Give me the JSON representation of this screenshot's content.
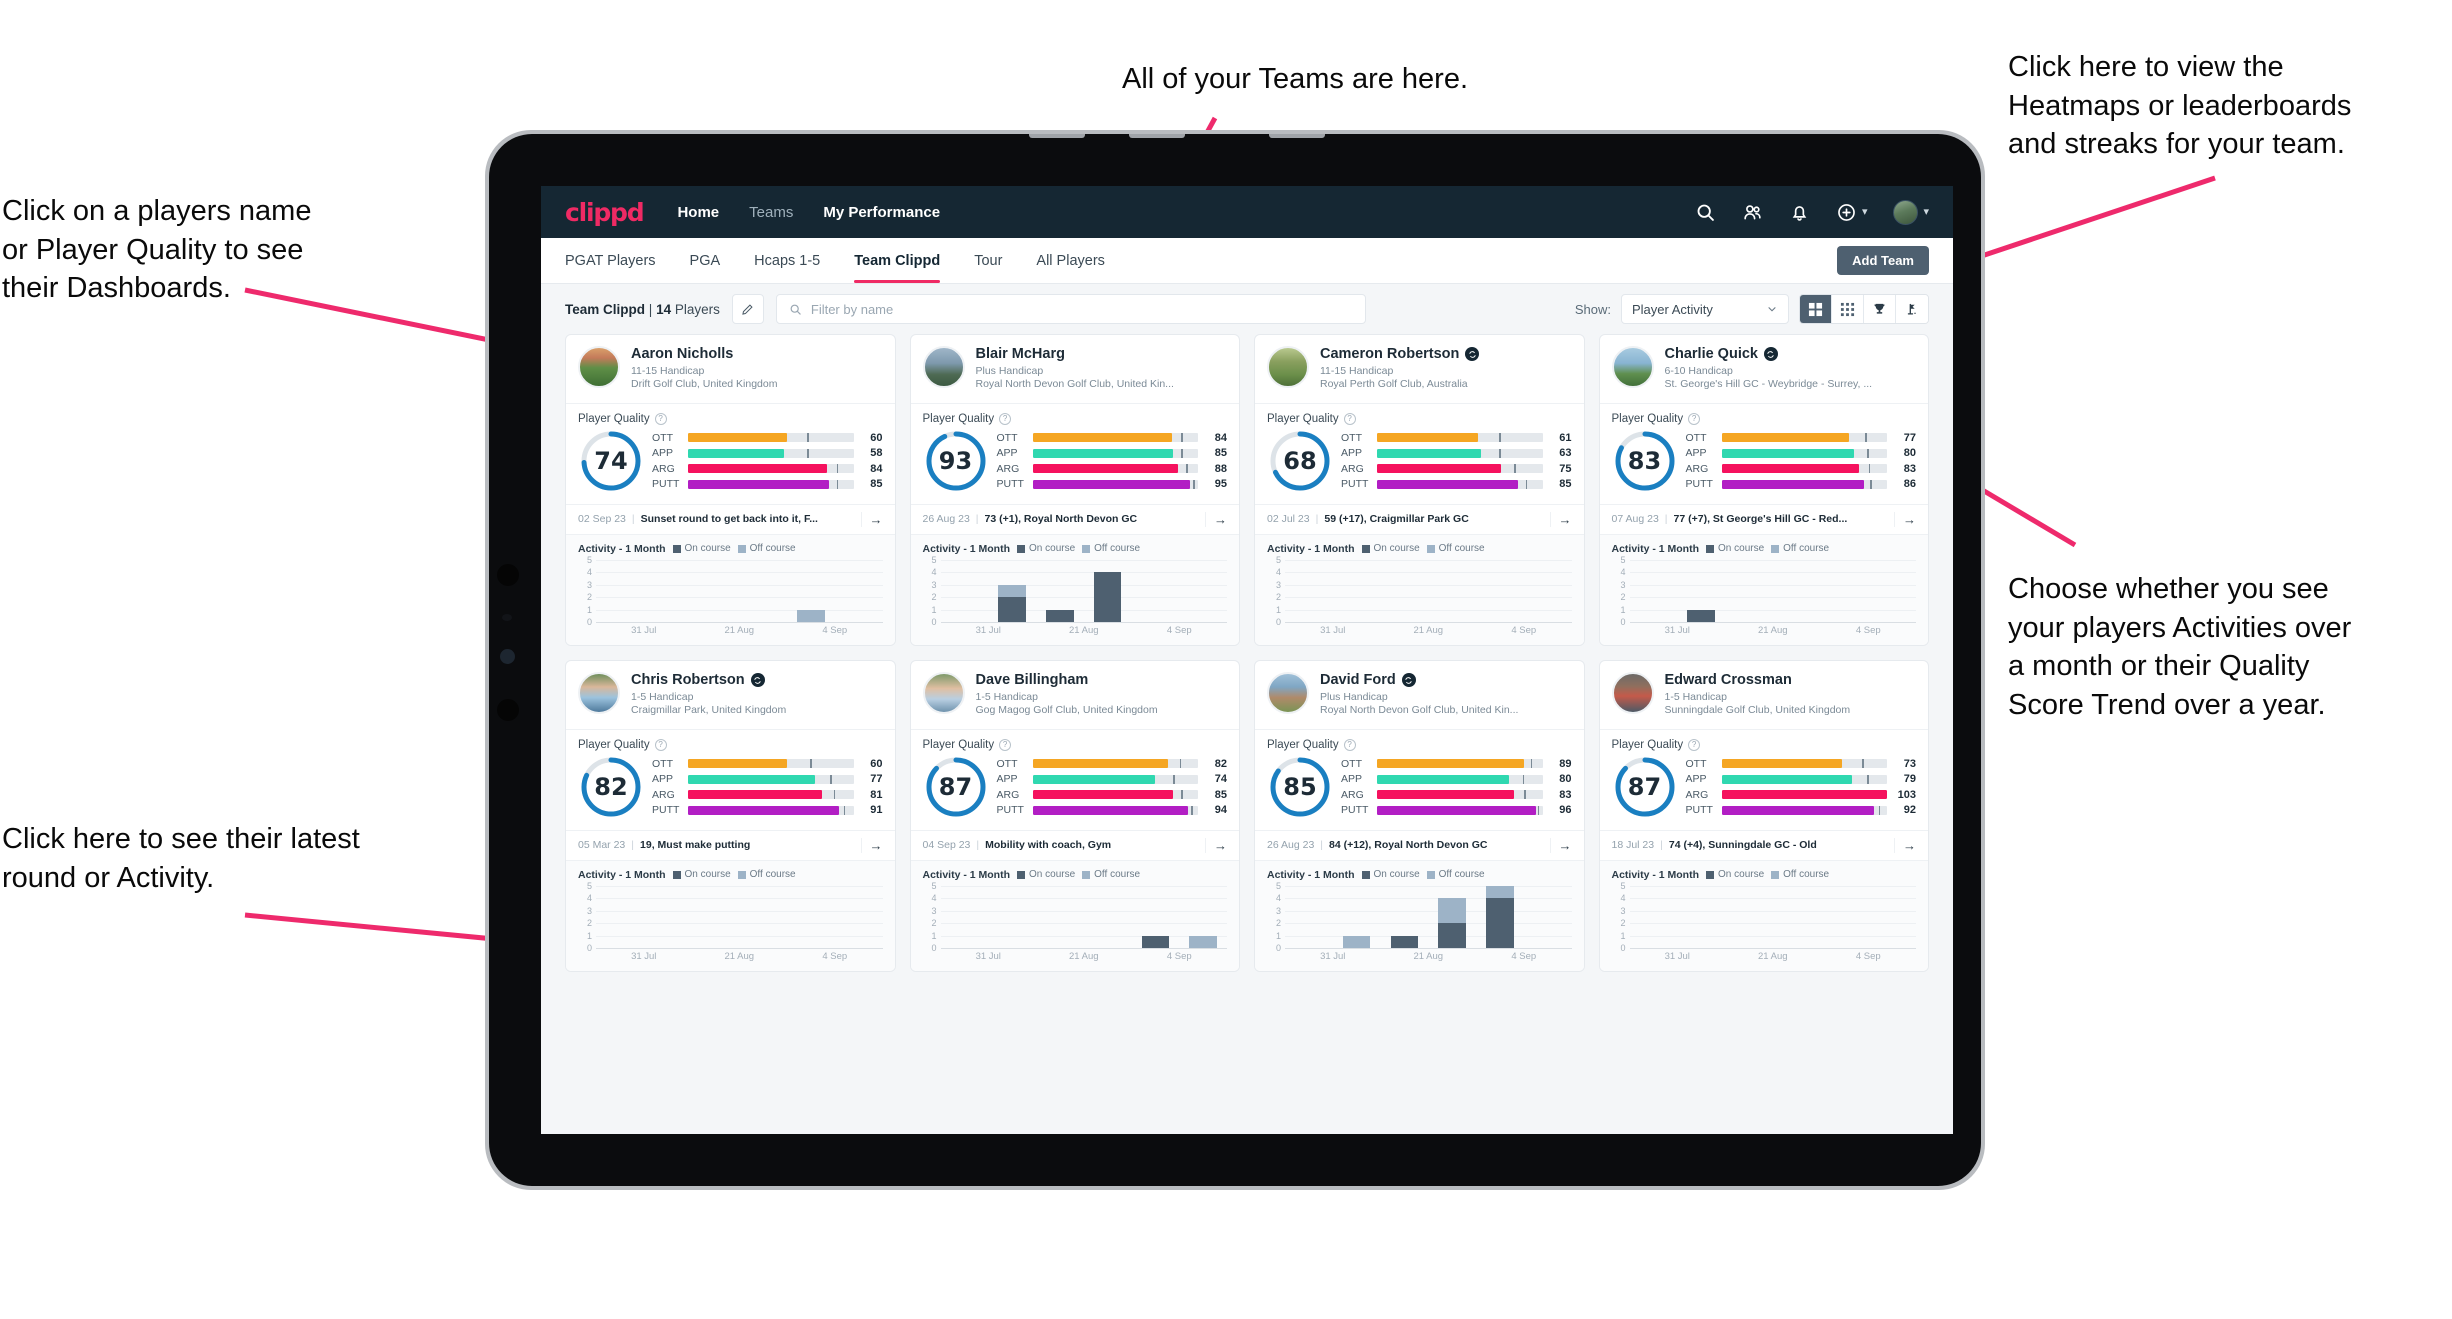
{
  "annotations": {
    "teams": "All of your Teams are here.",
    "heatmaps": "Click here to view the\nHeatmaps or leaderboards\nand streaks for your team.",
    "player_names": "Click on a players name\nor Player Quality to see\ntheir Dashboards.",
    "choose": "Choose whether you see\nyour players Activities over\na month or their Quality\nScore Trend over a year.",
    "latest": "Click here to see their latest\nround or Activity."
  },
  "app": {
    "logo": "clippd",
    "nav_links": [
      {
        "label": "Home",
        "active": true
      },
      {
        "label": "Teams",
        "active": false
      },
      {
        "label": "My Performance",
        "active": true
      }
    ],
    "nav_icons": [
      "search-icon",
      "people-icon",
      "bell-icon",
      "plus-circle-icon",
      "avatar"
    ],
    "tabs": [
      {
        "label": "PGAT Players",
        "active": false
      },
      {
        "label": "PGA",
        "active": false
      },
      {
        "label": "Hcaps 1-5",
        "active": false
      },
      {
        "label": "Team Clippd",
        "active": true
      },
      {
        "label": "Tour",
        "active": false
      },
      {
        "label": "All Players",
        "active": false
      }
    ],
    "add_team_label": "Add Team",
    "filter": {
      "team_name": "Team Clippd",
      "separator": "|",
      "player_count": "14",
      "players_word": "Players",
      "edit_icon": "pencil-icon",
      "search_placeholder": "Filter by name",
      "search_value": "",
      "show_label": "Show:",
      "show_value": "Player Activity",
      "show_options": [
        "Player Activity",
        "Quality Score Trend"
      ],
      "view_buttons": [
        {
          "name": "grid-view-icon",
          "active": true
        },
        {
          "name": "heatmap-view-icon",
          "active": false
        },
        {
          "name": "leaderboard-trophy-icon",
          "active": false
        },
        {
          "name": "streaks-flag-icon",
          "active": false
        }
      ]
    },
    "card_labels": {
      "player_quality": "Player Quality",
      "activity": "Activity - 1 Month",
      "legend_on": "On course",
      "legend_off": "Off course",
      "metric_labels": [
        "OTT",
        "APP",
        "ARG",
        "PUTT"
      ],
      "x_ticks": [
        "31 Jul",
        "21 Aug",
        "4 Sep"
      ],
      "y_ticks": [
        "5",
        "4",
        "3",
        "2",
        "1",
        "0"
      ]
    },
    "colors": {
      "brand_pink": "#ef2a64",
      "nav_dark": "#152733",
      "ott": "#f5a623",
      "app": "#2fd8b0",
      "arg": "#f5125e",
      "putt": "#b21ec4",
      "ring": "#1a7fc1",
      "on_course": "#4e6070",
      "off_course": "#9db3c7"
    }
  },
  "players": [
    {
      "name": "Aaron Nicholls",
      "verified": false,
      "handicap": "11-15 Handicap",
      "club": "Drift Golf Club, United Kingdom",
      "quality": 74,
      "avatar_style": "linear-gradient(180deg,#d9a06a 0%,#c47a5a 26%,#5f8f47 52%,#3f6f34 100%)",
      "metrics": [
        {
          "label": "OTT",
          "value": 60,
          "tick": 72
        },
        {
          "label": "APP",
          "value": 58,
          "tick": 72
        },
        {
          "label": "ARG",
          "value": 84,
          "tick": 90
        },
        {
          "label": "PUTT",
          "value": 85,
          "tick": 90
        }
      ],
      "round_date": "02 Sep 23",
      "round_text": "Sunset round to get back into it, F...",
      "activity": [
        {
          "on": 0,
          "off": 0
        },
        {
          "on": 0,
          "off": 0
        },
        {
          "on": 0,
          "off": 0
        },
        {
          "on": 0,
          "off": 0
        },
        {
          "on": 0,
          "off": 1
        },
        {
          "on": 0,
          "off": 0
        }
      ]
    },
    {
      "name": "Blair McHarg",
      "verified": false,
      "handicap": "Plus Handicap",
      "club": "Royal North Devon Golf Club, United Kin...",
      "quality": 93,
      "avatar_style": "linear-gradient(180deg,#9fb6c9 0%,#7e99ad 40%,#4e6a53 70%,#3c5a42 100%)",
      "metrics": [
        {
          "label": "OTT",
          "value": 84,
          "tick": 90
        },
        {
          "label": "APP",
          "value": 85,
          "tick": 90
        },
        {
          "label": "ARG",
          "value": 88,
          "tick": 93
        },
        {
          "label": "PUTT",
          "value": 95,
          "tick": 97
        }
      ],
      "round_date": "26 Aug 23",
      "round_text": "73 (+1), Royal North Devon GC",
      "activity": [
        {
          "on": 0,
          "off": 0
        },
        {
          "on": 2,
          "off": 1
        },
        {
          "on": 1,
          "off": 0
        },
        {
          "on": 4,
          "off": 0
        },
        {
          "on": 0,
          "off": 0
        },
        {
          "on": 0,
          "off": 0
        }
      ]
    },
    {
      "name": "Cameron Robertson",
      "verified": true,
      "handicap": "11-15 Handicap",
      "club": "Royal Perth Golf Club, Australia",
      "quality": 68,
      "avatar_style": "linear-gradient(180deg,#b9c98f 0%,#8aa05f 35%,#6b8f4a 70%,#4e7038 100%)",
      "metrics": [
        {
          "label": "OTT",
          "value": 61,
          "tick": 74
        },
        {
          "label": "APP",
          "value": 63,
          "tick": 74
        },
        {
          "label": "ARG",
          "value": 75,
          "tick": 83
        },
        {
          "label": "PUTT",
          "value": 85,
          "tick": 90
        }
      ],
      "round_date": "02 Jul 23",
      "round_text": "59 (+17), Craigmillar Park GC",
      "activity": [
        {
          "on": 0,
          "off": 0
        },
        {
          "on": 0,
          "off": 0
        },
        {
          "on": 0,
          "off": 0
        },
        {
          "on": 0,
          "off": 0
        },
        {
          "on": 0,
          "off": 0
        },
        {
          "on": 0,
          "off": 0
        }
      ]
    },
    {
      "name": "Charlie Quick",
      "verified": true,
      "handicap": "6-10 Handicap",
      "club": "St. George's Hill GC - Weybridge - Surrey, ...",
      "quality": 83,
      "avatar_style": "linear-gradient(180deg,#a8cbe0 0%,#88b4d2 40%,#5f8f4e 68%,#42703a 100%)",
      "metrics": [
        {
          "label": "OTT",
          "value": 77,
          "tick": 87
        },
        {
          "label": "APP",
          "value": 80,
          "tick": 88
        },
        {
          "label": "ARG",
          "value": 83,
          "tick": 89
        },
        {
          "label": "PUTT",
          "value": 86,
          "tick": 90
        }
      ],
      "round_date": "07 Aug 23",
      "round_text": "77 (+7), St George's Hill GC - Red...",
      "activity": [
        {
          "on": 0,
          "off": 0
        },
        {
          "on": 1,
          "off": 0
        },
        {
          "on": 0,
          "off": 0
        },
        {
          "on": 0,
          "off": 0
        },
        {
          "on": 0,
          "off": 0
        },
        {
          "on": 0,
          "off": 0
        }
      ]
    },
    {
      "name": "Chris Robertson",
      "verified": true,
      "handicap": "1-5 Handicap",
      "club": "Craigmillar Park, United Kingdom",
      "quality": 82,
      "avatar_style": "linear-gradient(180deg,#6f8f5c 0%,#d9b79a 34%,#9cc3de 62%,#4f7a9c 100%)",
      "metrics": [
        {
          "label": "OTT",
          "value": 60,
          "tick": 74
        },
        {
          "label": "APP",
          "value": 77,
          "tick": 86
        },
        {
          "label": "ARG",
          "value": 81,
          "tick": 88
        },
        {
          "label": "PUTT",
          "value": 91,
          "tick": 94
        }
      ],
      "round_date": "05 Mar 23",
      "round_text": "19, Must make putting",
      "activity": [
        {
          "on": 0,
          "off": 0
        },
        {
          "on": 0,
          "off": 0
        },
        {
          "on": 0,
          "off": 0
        },
        {
          "on": 0,
          "off": 0
        },
        {
          "on": 0,
          "off": 0
        },
        {
          "on": 0,
          "off": 0
        }
      ]
    },
    {
      "name": "Dave Billingham",
      "verified": false,
      "handicap": "1-5 Handicap",
      "club": "Gog Magog Golf Club, United Kingdom",
      "quality": 87,
      "avatar_style": "linear-gradient(180deg,#7e9a6b 0%,#e0bfa2 38%,#b9cfe2 66%,#6f93ad 100%)",
      "metrics": [
        {
          "label": "OTT",
          "value": 82,
          "tick": 89
        },
        {
          "label": "APP",
          "value": 74,
          "tick": 85
        },
        {
          "label": "ARG",
          "value": 85,
          "tick": 90
        },
        {
          "label": "PUTT",
          "value": 94,
          "tick": 96
        }
      ],
      "round_date": "04 Sep 23",
      "round_text": "Mobility with coach, Gym",
      "activity": [
        {
          "on": 0,
          "off": 0
        },
        {
          "on": 0,
          "off": 0
        },
        {
          "on": 0,
          "off": 0
        },
        {
          "on": 0,
          "off": 0
        },
        {
          "on": 1,
          "off": 0
        },
        {
          "on": 0,
          "off": 1
        }
      ]
    },
    {
      "name": "David Ford",
      "verified": true,
      "handicap": "Plus Handicap",
      "club": "Royal North Devon Golf Club, United Kin...",
      "quality": 85,
      "avatar_style": "linear-gradient(180deg,#9fc0d8 0%,#7fa6c4 34%,#b08a6a 62%,#7a9455 100%)",
      "metrics": [
        {
          "label": "OTT",
          "value": 89,
          "tick": 93
        },
        {
          "label": "APP",
          "value": 80,
          "tick": 88
        },
        {
          "label": "ARG",
          "value": 83,
          "tick": 89
        },
        {
          "label": "PUTT",
          "value": 96,
          "tick": 97
        }
      ],
      "round_date": "26 Aug 23",
      "round_text": "84 (+12), Royal North Devon GC",
      "activity": [
        {
          "on": 0,
          "off": 0
        },
        {
          "on": 0,
          "off": 1
        },
        {
          "on": 1,
          "off": 0
        },
        {
          "on": 2,
          "off": 2
        },
        {
          "on": 4,
          "off": 1
        },
        {
          "on": 0,
          "off": 0
        }
      ]
    },
    {
      "name": "Edward Crossman",
      "verified": false,
      "handicap": "1-5 Handicap",
      "club": "Sunningdale Golf Club, United Kingdom",
      "quality": 87,
      "avatar_style": "linear-gradient(180deg,#6d6a68 0%,#8f6f5e 32%,#c45a4a 58%,#4c5a66 100%)",
      "metrics": [
        {
          "label": "OTT",
          "value": 73,
          "tick": 85
        },
        {
          "label": "APP",
          "value": 79,
          "tick": 88
        },
        {
          "label": "ARG",
          "value": 103,
          "tick": 0
        },
        {
          "label": "PUTT",
          "value": 92,
          "tick": 95
        }
      ],
      "round_date": "18 Jul 23",
      "round_text": "74 (+4), Sunningdale GC - Old",
      "activity": [
        {
          "on": 0,
          "off": 0
        },
        {
          "on": 0,
          "off": 0
        },
        {
          "on": 0,
          "off": 0
        },
        {
          "on": 0,
          "off": 0
        },
        {
          "on": 0,
          "off": 0
        },
        {
          "on": 0,
          "off": 0
        }
      ]
    }
  ]
}
